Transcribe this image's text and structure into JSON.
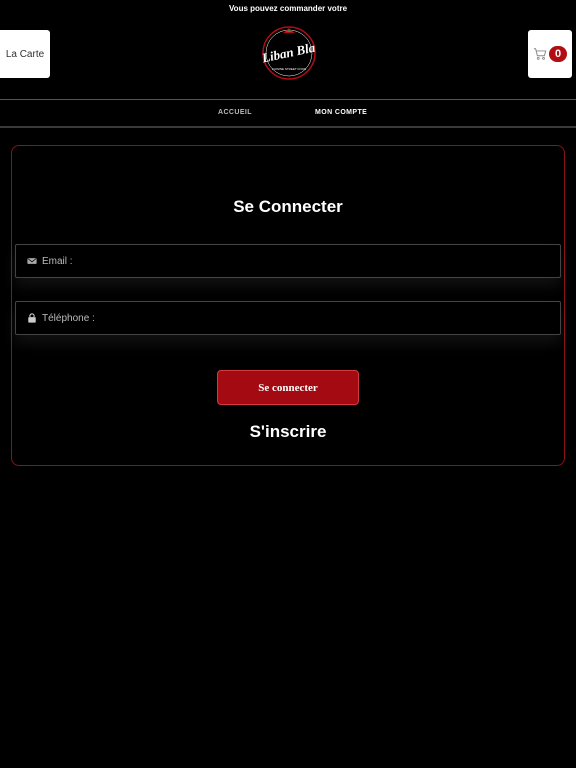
{
  "banner": {
    "text": "Vous pouvez commander votre"
  },
  "header": {
    "menu_label": "La Carte",
    "logo_text": "Liban Bla",
    "logo_subtext": "CUISINE STREET FOOD",
    "cart_count": "0"
  },
  "nav": {
    "items": [
      {
        "label": "ACCUEIL"
      },
      {
        "label": "MON COMPTE"
      }
    ]
  },
  "login": {
    "title": "Se Connecter",
    "email_placeholder": "Email :",
    "phone_placeholder": "Téléphone :",
    "submit_label": "Se connecter",
    "signup_label": "S'inscrire"
  },
  "colors": {
    "background": "#000000",
    "accent": "#a30a12",
    "card_border": "#8a1218"
  },
  "icons": {
    "cart": "shopping-cart-icon",
    "email": "envelope-icon",
    "phone": "lock-icon"
  }
}
